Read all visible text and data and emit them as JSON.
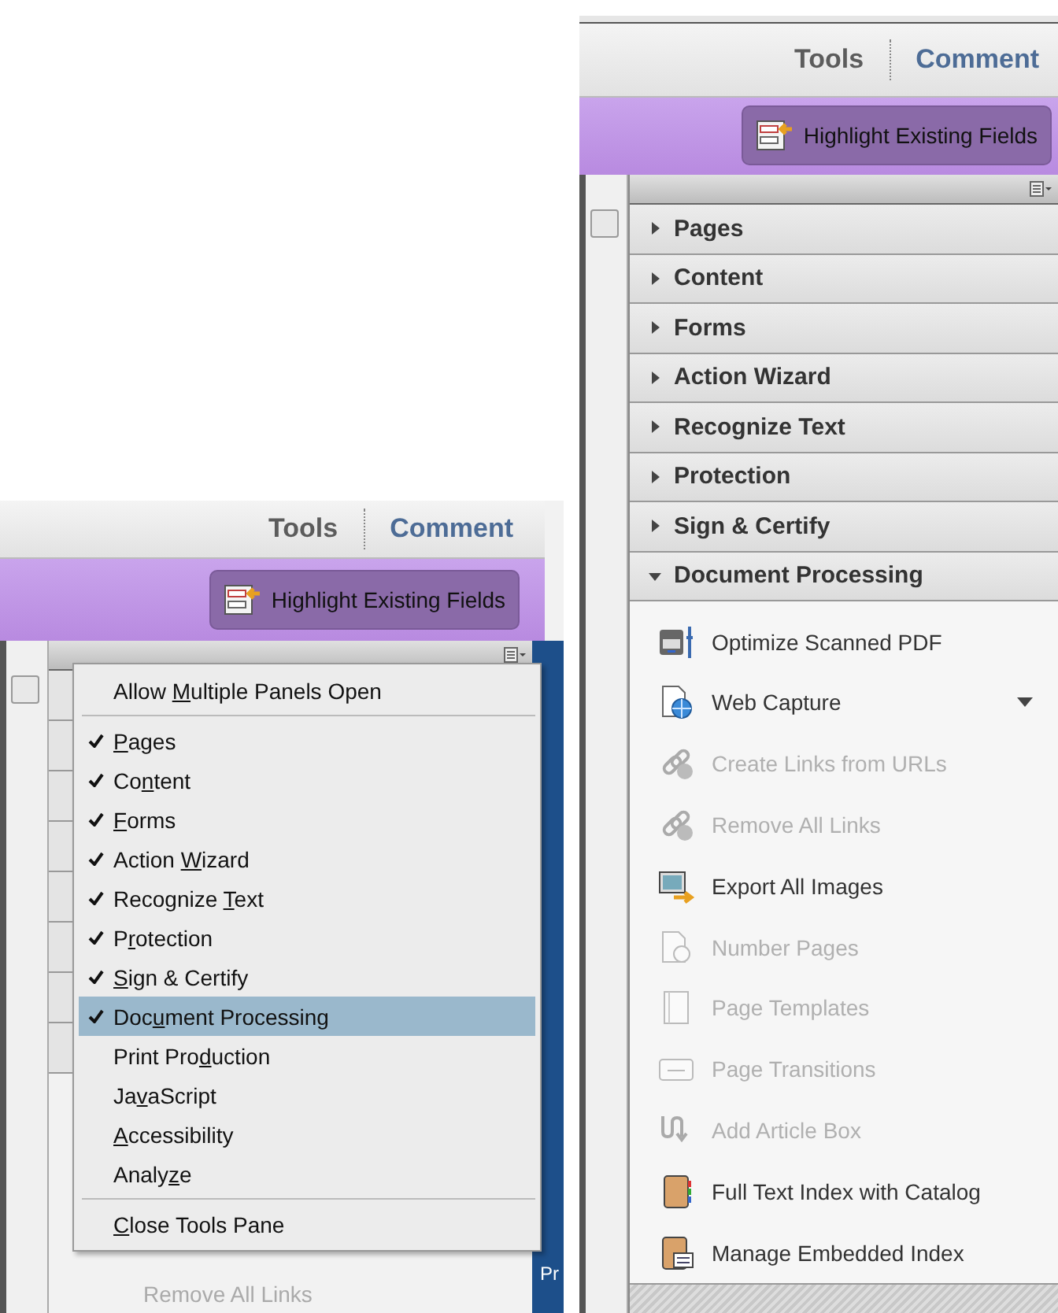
{
  "left_panel": {
    "tabs": [
      {
        "label": "Tools",
        "color": "#5c5c5c"
      },
      {
        "label": "Comment",
        "color": "#4d6c96"
      }
    ],
    "toolbar_button": "Highlight Existing Fields",
    "menu": [
      {
        "kind": "command",
        "pre": "Allow ",
        "key": "M",
        "post": "ultiple Panels Open",
        "selected": false
      },
      {
        "kind": "separator"
      },
      {
        "kind": "panel",
        "key": "P",
        "post": "ages",
        "checked": true,
        "selected": false
      },
      {
        "kind": "panel",
        "pre": "Co",
        "key": "n",
        "post": "tent",
        "checked": true,
        "selected": false
      },
      {
        "kind": "panel",
        "key": "F",
        "post": "orms",
        "checked": true,
        "selected": false
      },
      {
        "kind": "panel",
        "pre": "Action ",
        "key": "W",
        "post": "izard",
        "checked": true,
        "selected": false
      },
      {
        "kind": "panel",
        "pre": "Recognize ",
        "key": "T",
        "post": "ext",
        "checked": true,
        "selected": false
      },
      {
        "kind": "panel",
        "pre": "P",
        "key": "r",
        "post": "otection",
        "checked": true,
        "selected": false
      },
      {
        "kind": "panel",
        "key": "S",
        "post": "ign & Certify",
        "checked": true,
        "selected": false
      },
      {
        "kind": "panel",
        "pre": "Doc",
        "key": "u",
        "post": "ment Processing",
        "checked": true,
        "selected": true
      },
      {
        "kind": "panel",
        "pre": "Print Pro",
        "key": "d",
        "post": "uction",
        "checked": false,
        "selected": false
      },
      {
        "kind": "panel",
        "pre": "Ja",
        "key": "v",
        "post": "aScript",
        "checked": false,
        "selected": false
      },
      {
        "kind": "panel",
        "key": "A",
        "post": "ccessibility",
        "checked": false,
        "selected": false
      },
      {
        "kind": "panel",
        "pre": "Analy",
        "key": "z",
        "post": "e",
        "checked": false,
        "selected": false
      },
      {
        "kind": "separator"
      },
      {
        "kind": "command",
        "key": "C",
        "post": "lose Tools Pane",
        "selected": false
      }
    ],
    "behind_text": "Pr",
    "partial_tool": "Remove All Links"
  },
  "right_panel": {
    "tabs": [
      {
        "label": "Tools",
        "color": "#5c5c5c"
      },
      {
        "label": "Comment",
        "color": "#4d6c96"
      }
    ],
    "toolbar_button": "Highlight Existing Fields",
    "sections": [
      {
        "label": "Pages",
        "expanded": false
      },
      {
        "label": "Content",
        "expanded": false
      },
      {
        "label": "Forms",
        "expanded": false
      },
      {
        "label": "Action Wizard",
        "expanded": false
      },
      {
        "label": "Recognize Text",
        "expanded": false
      },
      {
        "label": "Protection",
        "expanded": false
      },
      {
        "label": "Sign & Certify",
        "expanded": false
      },
      {
        "label": "Document Processing",
        "expanded": true
      }
    ],
    "tools": [
      {
        "label": "Optimize Scanned PDF",
        "disabled": false
      },
      {
        "label": "Web Capture",
        "disabled": false,
        "has_menu": true
      },
      {
        "label": "Create Links from URLs",
        "disabled": true
      },
      {
        "label": "Remove All Links",
        "disabled": true
      },
      {
        "label": "Export All Images",
        "disabled": false
      },
      {
        "label": "Number Pages",
        "disabled": true
      },
      {
        "label": "Page Templates",
        "disabled": true
      },
      {
        "label": "Page Transitions",
        "disabled": true
      },
      {
        "label": "Add Article Box",
        "disabled": true
      },
      {
        "label": "Full Text Index with Catalog",
        "disabled": false
      },
      {
        "label": "Manage Embedded Index",
        "disabled": false
      }
    ]
  }
}
